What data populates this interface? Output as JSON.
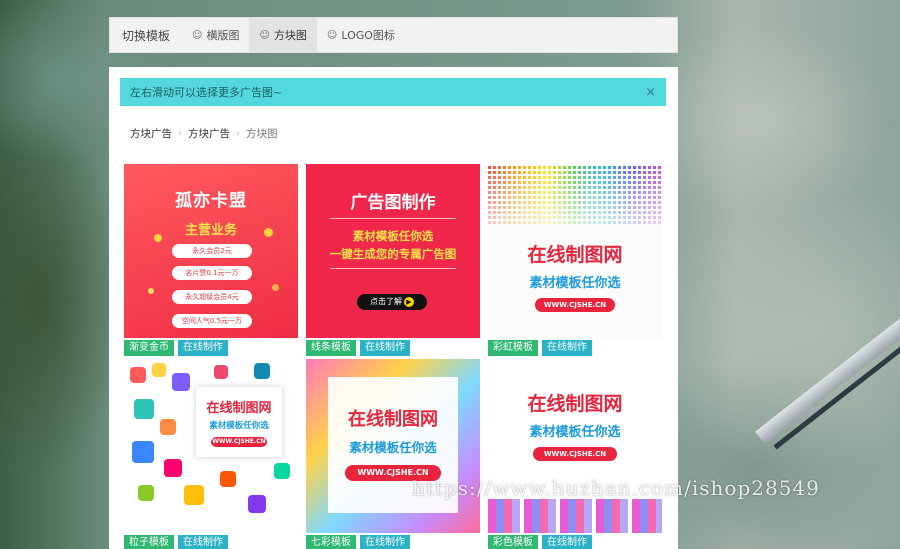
{
  "tabbar": {
    "label": "切换模板",
    "tabs": [
      {
        "label": "横版图",
        "active": false
      },
      {
        "label": "方块图",
        "active": true
      },
      {
        "label": "LOGO图标",
        "active": false
      }
    ]
  },
  "alert": {
    "text": "左右滑动可以选择更多广告图~",
    "close": "×"
  },
  "breadcrumb": [
    "方块广告",
    "方块广告",
    "方块图"
  ],
  "cards": [
    {
      "category": "渐变金币",
      "action": "在线制作",
      "art": {
        "title": "孤亦卡盟",
        "subtitle": "主营业务",
        "items": [
          "永久会员2元",
          "名片赞0.1元一万",
          "永久超级会员4元",
          "空间人气0.5元一万"
        ]
      }
    },
    {
      "category": "线条模板",
      "action": "在线制作",
      "art": {
        "title": "广告图制作",
        "line1": "素材模板任你选",
        "line2": "一键生成您的专属广告图",
        "button": "点击了解"
      }
    },
    {
      "category": "彩虹模板",
      "action": "在线制作",
      "art": {
        "title": "在线制图网",
        "subtitle": "素材模板任你选",
        "url": "WWW.CJSHE.CN"
      }
    },
    {
      "category": "粒子模板",
      "action": "在线制作",
      "art": {
        "title": "在线制图网",
        "subtitle": "素材模板任你选",
        "url": "WWW.CJSHE.CN"
      }
    },
    {
      "category": "七彩模板",
      "action": "在线制作",
      "art": {
        "title": "在线制图网",
        "subtitle": "素材模板任你选",
        "url": "WWW.CJSHE.CN"
      }
    },
    {
      "category": "彩色模板",
      "action": "在线制作",
      "art": {
        "title": "在线制图网",
        "subtitle": "素材模板任你选",
        "url": "WWW.CJSHE.CN"
      }
    }
  ],
  "watermark": "https://www.huzhan.com/ishop28549",
  "colors": {
    "alert_bg": "#53d9dd",
    "tag_category": "#2eb872",
    "tag_action": "#2bb2c6",
    "brand_red": "#e8253d",
    "brand_blue": "#1b9be0"
  },
  "icons": {
    "tab_icon": "smile-icon",
    "close": "close-icon",
    "breadcrumb_sep": "chevron-right-icon"
  }
}
